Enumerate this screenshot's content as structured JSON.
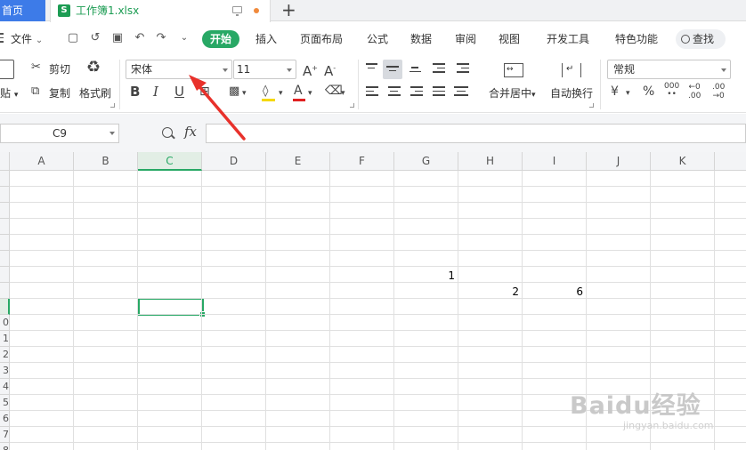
{
  "tabs": {
    "home": "首页",
    "doc": "工作簿1.xlsx",
    "add": "+"
  },
  "menu": {
    "file": "文件",
    "tabs": [
      "开始",
      "插入",
      "页面布局",
      "公式",
      "数据",
      "审阅",
      "视图",
      "开发工具",
      "特色功能"
    ],
    "active_tab": "开始",
    "search": "查找"
  },
  "ribbon": {
    "paste": "贴",
    "cut": "剪切",
    "copy": "复制",
    "format_painter": "格式刷",
    "font_name": "宋体",
    "font_size": "11",
    "merge_center": "合并居中",
    "wrap_text": "自动换行",
    "number_format": "常规",
    "font_color": "#e02020",
    "fill_color": "#f5d800"
  },
  "formula_bar": {
    "name_box": "C9",
    "fx": "fx",
    "content": ""
  },
  "grid": {
    "columns": [
      "A",
      "B",
      "C",
      "D",
      "E",
      "F",
      "G",
      "H",
      "I",
      "J",
      "K"
    ],
    "selected_column": "C",
    "row_labels": [
      "",
      "",
      "",
      "",
      "",
      "",
      "",
      "",
      "",
      "0",
      "1",
      "2",
      "3",
      "4",
      "5",
      "6",
      "7",
      "8"
    ],
    "cells": [
      {
        "ref": "G7",
        "value": "1"
      },
      {
        "ref": "H8",
        "value": "2"
      },
      {
        "ref": "I8",
        "value": "6"
      }
    ]
  },
  "watermark": {
    "brand": "Baidu经验",
    "url": "jingyan.baidu.com"
  },
  "annotation_color": "#e8312b"
}
